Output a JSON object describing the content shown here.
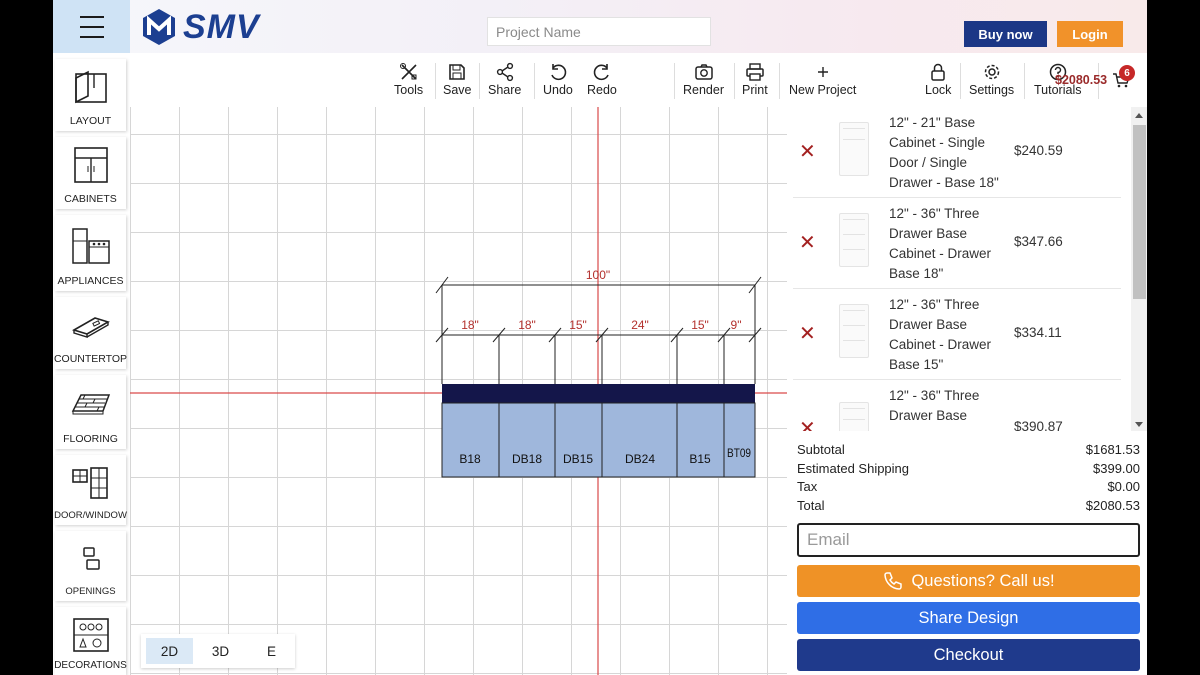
{
  "header": {
    "logo_text": "SMV",
    "project_placeholder": "Project Name",
    "buy_label": "Buy now",
    "login_label": "Login"
  },
  "sidebar": {
    "items": [
      {
        "label": "LAYOUT",
        "icon": "layout-icon"
      },
      {
        "label": "CABINETS",
        "icon": "cabinet-icon"
      },
      {
        "label": "APPLIANCES",
        "icon": "appliance-icon"
      },
      {
        "label": "COUNTERTOP",
        "icon": "countertop-icon"
      },
      {
        "label": "FLOORING",
        "icon": "flooring-icon"
      },
      {
        "label": "DOOR/WINDOW",
        "icon": "door-window-icon"
      },
      {
        "label": "OPENINGS",
        "icon": "openings-icon"
      },
      {
        "label": "DECORATIONS",
        "icon": "decorations-icon"
      }
    ]
  },
  "toolbar": {
    "tools": [
      "Tools",
      "Save",
      "Share",
      "Undo",
      "Redo",
      "Render",
      "Print",
      "New Project"
    ],
    "right_tools": [
      "Lock",
      "Settings",
      "Tutorials"
    ],
    "cart_total": "$2080.53",
    "cart_count": "6"
  },
  "view_toggle": {
    "options": [
      "2D",
      "3D",
      "E"
    ],
    "active": "2D"
  },
  "drawing": {
    "overall": "100\"",
    "segments": [
      "18\"",
      "18\"",
      "15\"",
      "24\"",
      "15\"",
      "9\""
    ],
    "cabinets": [
      "B18",
      "DB18",
      "DB15",
      "DB24",
      "B15",
      "BT09"
    ]
  },
  "cart": {
    "items": [
      {
        "name": "12\" - 21\" Base Cabinet - Single Door / Single Drawer - Base 18\"",
        "price": "$240.59"
      },
      {
        "name": "12\" - 36\" Three Drawer Base Cabinet - Drawer Base 18\"",
        "price": "$347.66"
      },
      {
        "name": "12\" - 36\" Three Drawer Base Cabinet - Drawer Base 15\"",
        "price": "$334.11"
      },
      {
        "name": "12\" - 36\" Three Drawer Base",
        "price": "$390.87"
      }
    ]
  },
  "summary": {
    "subtotal_label": "Subtotal",
    "subtotal": "$1681.53",
    "shipping_label": "Estimated Shipping",
    "shipping": "$399.00",
    "tax_label": "Tax",
    "tax": "$0.00",
    "total_label": "Total",
    "total": "$2080.53"
  },
  "email_placeholder": "Email",
  "buttons": {
    "call": "Questions? Call us!",
    "share": "Share Design",
    "checkout": "Checkout"
  },
  "colors": {
    "brand": "#1c3f91",
    "accent_orange": "#ef9226",
    "share_blue": "#2f6ee6",
    "checkout_navy": "#1f3a8c",
    "cabinet_fill": "#9fb7dc",
    "countertop": "#14164a",
    "dimension_red": "#b3302c"
  }
}
